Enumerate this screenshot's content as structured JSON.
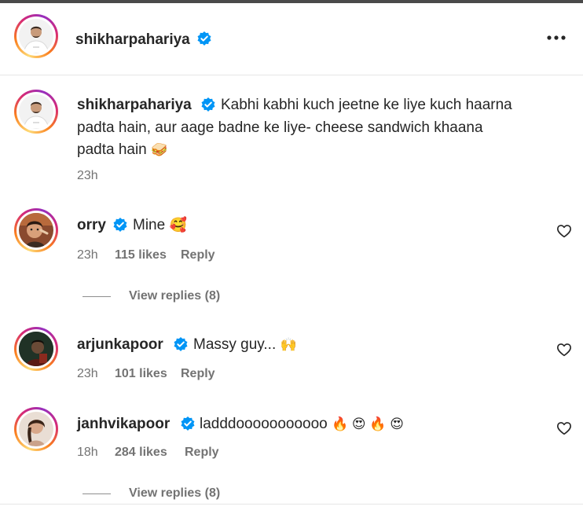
{
  "header": {
    "username": "shikharpahariya"
  },
  "caption": {
    "username": "shikharpahariya",
    "line1": "Kabhi kabhi kuch jeetne ke liye kuch haarna",
    "line2": "padta hain, aur aage badne ke liye- cheese sandwich khaana",
    "line3": "padta hain",
    "line3_emoji": "🥪",
    "time": "23h"
  },
  "comments": [
    {
      "username": "orry",
      "text": "Mine",
      "emoji": "🥰",
      "time": "23h",
      "likes": "115 likes",
      "reply": "Reply",
      "view_replies": "View replies (8)"
    },
    {
      "username": "arjunkapoor",
      "text": "Massy guy...",
      "emoji": "🙌",
      "time": "23h",
      "likes": "101 likes",
      "reply": "Reply"
    },
    {
      "username": "janhvikapoor",
      "text": "ladddooooooooooo",
      "emoji": "🔥 😍 🔥 😍",
      "time": "18h",
      "likes": "284 likes",
      "reply": "Reply",
      "view_replies": "View replies (8)"
    }
  ],
  "icons": {
    "verified": "verified-badge-icon",
    "more": "more-options-icon",
    "like": "heart-icon"
  },
  "colors": {
    "verified_blue": "#0095f6",
    "meta_gray": "#737373",
    "text": "#262626"
  }
}
